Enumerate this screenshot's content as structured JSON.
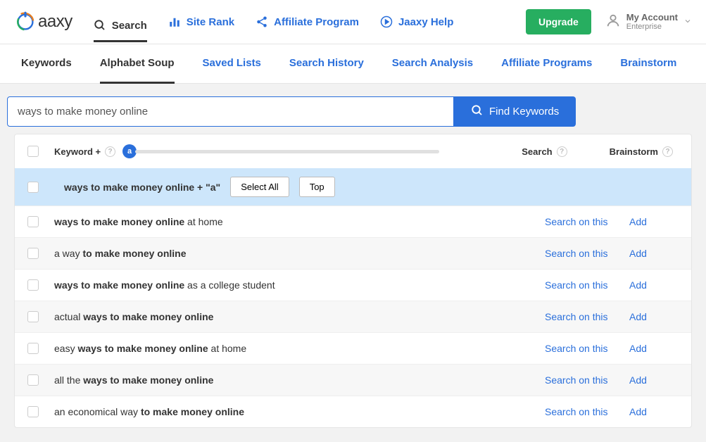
{
  "brand": "aaxy",
  "nav": {
    "search": "Search",
    "siterank": "Site Rank",
    "affiliate": "Affiliate Program",
    "help": "Jaaxy Help"
  },
  "upgrade": "Upgrade",
  "account": {
    "title": "My Account",
    "sub": "Enterprise"
  },
  "subnav": {
    "keywords": "Keywords",
    "alphabet": "Alphabet Soup",
    "saved": "Saved Lists",
    "history": "Search History",
    "analysis": "Search Analysis",
    "affprog": "Affiliate Programs",
    "brainstorm": "Brainstorm"
  },
  "search": {
    "value": "ways to make money online",
    "button": "Find Keywords"
  },
  "columns": {
    "keyword": "Keyword +",
    "search": "Search",
    "brainstorm": "Brainstorm"
  },
  "slider": {
    "letter": "a"
  },
  "filter": {
    "label": "ways to make money online + \"a\"",
    "selectall": "Select All",
    "top": "Top"
  },
  "actions": {
    "search": "Search on this",
    "add": "Add"
  },
  "rows": [
    {
      "pre": "",
      "bold": "ways to make money online",
      "post": " at home"
    },
    {
      "pre": "a way ",
      "bold": "to make money online",
      "post": ""
    },
    {
      "pre": "",
      "bold": "ways to make money online",
      "post": " as a college student"
    },
    {
      "pre": "actual ",
      "bold": "ways to make money online",
      "post": ""
    },
    {
      "pre": "easy ",
      "bold": "ways to make money online",
      "post": " at home"
    },
    {
      "pre": "all the ",
      "bold": "ways to make money online",
      "post": ""
    },
    {
      "pre": "an economical way ",
      "bold": "to make money online",
      "post": ""
    }
  ]
}
